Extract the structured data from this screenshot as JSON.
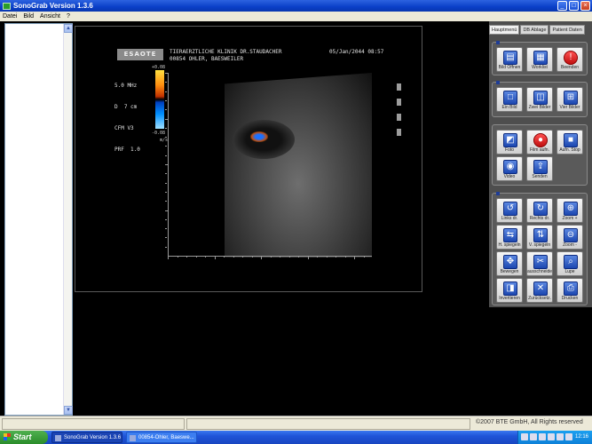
{
  "window": {
    "title": "SonoGrab Version 1.3.6",
    "minimize": "_",
    "maximize": "□",
    "close": "×"
  },
  "menu": [
    "Datei",
    "Bild",
    "Ansicht",
    "?"
  ],
  "image": {
    "brand": "ESAOTE",
    "clinic_line1": "TIERAERZTLICHE KLINIK DR.STAUDACHER",
    "clinic_line2": "00854 OHLER, BAESWEILER",
    "datetime": "05/Jan/2044 08:57",
    "params": [
      "5.0 MHz",
      "D  7 cm",
      "CFM V3",
      "PRF  1.0"
    ],
    "scale_top": "+0.08",
    "scale_bottom": "-0.08\n   m/s"
  },
  "tabs": [
    {
      "label": "Hauptmenü",
      "active": true
    },
    {
      "label": "DB Ablage",
      "active": false
    },
    {
      "label": "Patient Daten",
      "active": false
    }
  ],
  "groups": {
    "g1": [
      {
        "name": "bild-oeffnen",
        "label": "Bild Öffnen",
        "icon": "▤",
        "kind": "blue"
      },
      {
        "name": "worklist",
        "label": "Worklist",
        "icon": "▦",
        "kind": "blue"
      },
      {
        "name": "beenden",
        "label": "Beenden",
        "icon": "!",
        "kind": "red"
      }
    ],
    "g2": [
      {
        "name": "ein-bild",
        "label": "Ein Bild",
        "icon": "□",
        "kind": "blue"
      },
      {
        "name": "zwei-bilder",
        "label": "Zwei Bilder",
        "icon": "◫",
        "kind": "blue"
      },
      {
        "name": "vier-bilder",
        "label": "Vier Bilder",
        "icon": "⊞",
        "kind": "blue"
      }
    ],
    "g3": [
      {
        "name": "foto",
        "label": "Foto",
        "icon": "◩",
        "kind": "blue"
      },
      {
        "name": "film-aufn",
        "label": "Film aufn.",
        "icon": "●",
        "kind": "red"
      },
      {
        "name": "aufn-stop",
        "label": "Aufn. Stop",
        "icon": "■",
        "kind": "blue"
      },
      {
        "name": "video",
        "label": "Video",
        "icon": "◉",
        "kind": "blue"
      },
      {
        "name": "senden",
        "label": "Senden",
        "icon": "⇪",
        "kind": "blue"
      }
    ],
    "g4": [
      {
        "name": "links-dr",
        "label": "Links dr.",
        "icon": "↺",
        "kind": "blue"
      },
      {
        "name": "rechts-dr",
        "label": "Rechts dr.",
        "icon": "↻",
        "kind": "blue"
      },
      {
        "name": "zoom-plus",
        "label": "Zoom +",
        "icon": "⊕",
        "kind": "blue"
      },
      {
        "name": "h-spiegeln",
        "label": "H. spiegeln",
        "icon": "⇆",
        "kind": "blue"
      },
      {
        "name": "v-spiegeln",
        "label": "V. spiegeln",
        "icon": "⇅",
        "kind": "blue"
      },
      {
        "name": "zoom-minus",
        "label": "Zoom -",
        "icon": "⊖",
        "kind": "blue"
      },
      {
        "name": "bewegen",
        "label": "Bewegen",
        "icon": "✥",
        "kind": "blue"
      },
      {
        "name": "ausschneiden",
        "label": "ausschneide",
        "icon": "✂",
        "kind": "blue"
      },
      {
        "name": "lupe",
        "label": "Lupe",
        "icon": "⌕",
        "kind": "blue"
      },
      {
        "name": "invertieren",
        "label": "Invertieren",
        "icon": "◨",
        "kind": "blue"
      },
      {
        "name": "zuruecksetzen",
        "label": "Zurücksetz.",
        "icon": "✕",
        "kind": "blue"
      },
      {
        "name": "drucken",
        "label": "Drucken",
        "icon": "⎙",
        "kind": "blue"
      }
    ]
  },
  "status": {
    "copyright": "©2007 BTE GmbH, All Rights reserved"
  },
  "taskbar": {
    "start": "Start",
    "tasks": [
      "SonoGrab Version 1.3.6",
      "00854-Ohler, Baeswe..."
    ],
    "clock": "12:16"
  }
}
